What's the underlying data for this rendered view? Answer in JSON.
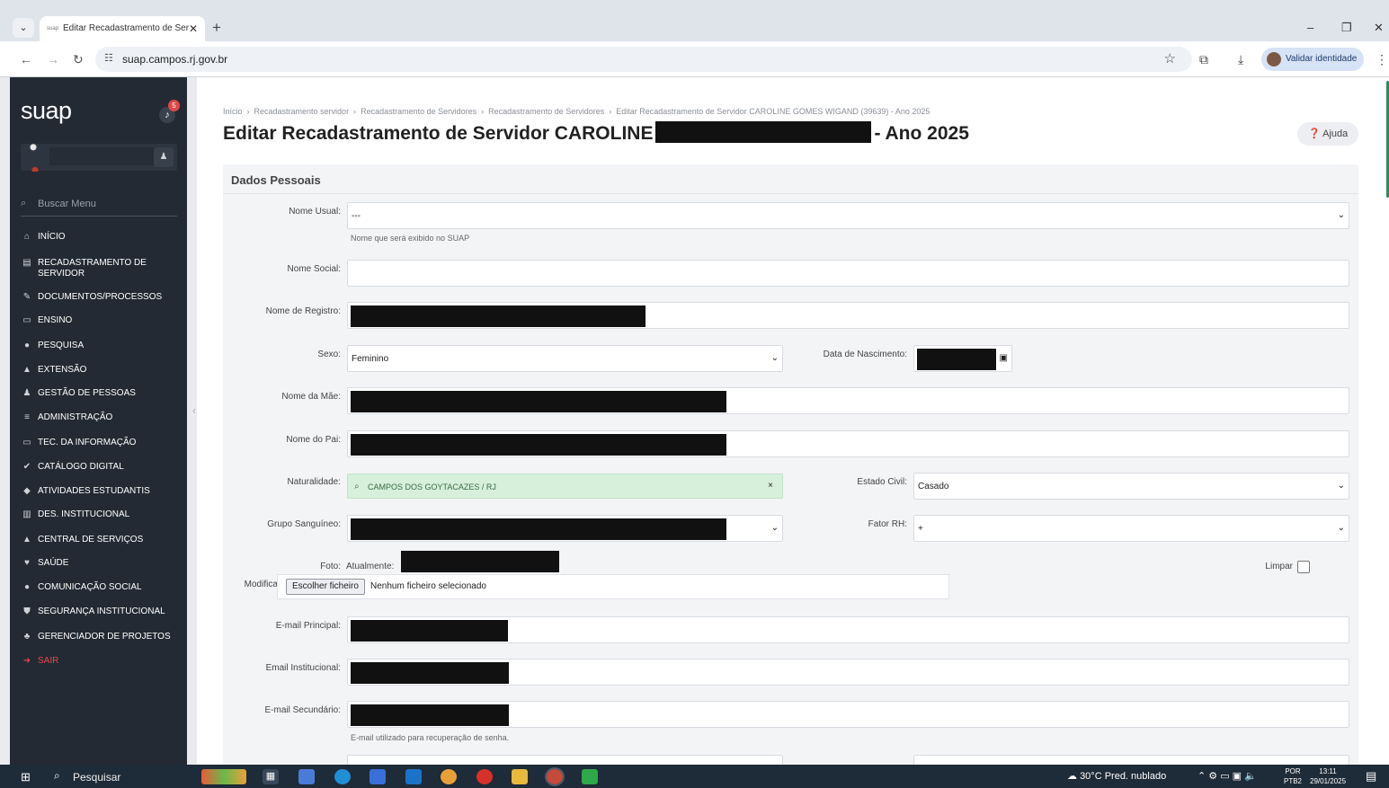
{
  "browser": {
    "tab_title": "Editar Recadastramento de Ser",
    "tab_favicon": "suap",
    "url": "suap.campos.rj.gov.br",
    "validate_identity_label": "Validar identidade"
  },
  "sidebar": {
    "brand": "suap",
    "notification_count": "5",
    "search_placeholder": "Buscar Menu",
    "items": [
      {
        "label": "Início",
        "icon": "home-icon",
        "glyph": "⌂"
      },
      {
        "label": "Recadastramento de Servidor",
        "icon": "file-icon",
        "glyph": "▤"
      },
      {
        "label": "Documentos/Processos",
        "icon": "edit-document-icon",
        "glyph": "✎"
      },
      {
        "label": "Ensino",
        "icon": "teaching-icon",
        "glyph": "▭"
      },
      {
        "label": "Pesquisa",
        "icon": "globe-icon",
        "glyph": "●"
      },
      {
        "label": "Extensão",
        "icon": "building-icon",
        "glyph": "▲"
      },
      {
        "label": "Gestão de Pessoas",
        "icon": "users-icon",
        "glyph": "♟"
      },
      {
        "label": "Administração",
        "icon": "list-icon",
        "glyph": "≡"
      },
      {
        "label": "Tec. da Informação",
        "icon": "laptop-icon",
        "glyph": "▭"
      },
      {
        "label": "Catálogo Digital",
        "icon": "check-circle-icon",
        "glyph": "✔"
      },
      {
        "label": "Atividades Estudantis",
        "icon": "graduation-cap-icon",
        "glyph": "◆"
      },
      {
        "label": "Des. Institucional",
        "icon": "bar-chart-icon",
        "glyph": "▥"
      },
      {
        "label": "Central de Serviços",
        "icon": "mountain-icon",
        "glyph": "▲"
      },
      {
        "label": "Saúde",
        "icon": "heart-icon",
        "glyph": "♥"
      },
      {
        "label": "Comunicação Social",
        "icon": "chat-bubble-icon",
        "glyph": "●"
      },
      {
        "label": "Segurança Institucional",
        "icon": "shield-icon",
        "glyph": "⛊"
      },
      {
        "label": "Gerenciador de Projetos",
        "icon": "sitemap-icon",
        "glyph": "♣"
      },
      {
        "label": "Sair",
        "icon": "sign-out-icon",
        "glyph": "➜"
      }
    ]
  },
  "breadcrumb": [
    "Início",
    "Recadastramento servidor",
    "Recadastramento de Servidores",
    "Recadastramento de Servidores",
    "Editar Recadastramento de Servidor CAROLINE GOMES WIGAND (39639) - Ano 2025"
  ],
  "page": {
    "title_prefix": "Editar Recadastramento de Servidor CAROLINE",
    "title_suffix": "- Ano 2025",
    "help_label": "Ajuda"
  },
  "form": {
    "section_title": "Dados Pessoais",
    "nome_usual": {
      "label": "Nome Usual:",
      "value": "---",
      "help": "Nome que será exibido no SUAP"
    },
    "nome_social": {
      "label": "Nome Social:",
      "value": ""
    },
    "nome_registro": {
      "label": "Nome de Registro:"
    },
    "sexo": {
      "label": "Sexo:",
      "value": "Feminino"
    },
    "data_nascimento": {
      "label": "Data de Nascimento:"
    },
    "nome_mae": {
      "label": "Nome da Mãe:"
    },
    "nome_pai": {
      "label": "Nome do Pai:"
    },
    "naturalidade": {
      "label": "Naturalidade:",
      "value": "CAMPOS DOS GOYTACAZES / RJ",
      "clear": "×"
    },
    "estado_civil": {
      "label": "Estado Civil:",
      "value": "Casado"
    },
    "grupo_sanguineo": {
      "label": "Grupo Sanguíneo:"
    },
    "fator_rh": {
      "label": "Fator RH:",
      "value": "+"
    },
    "foto": {
      "label": "Foto:",
      "current_label": "Atualmente:",
      "modify_label": "Modificar:",
      "button_label": "Escolher ficheiro",
      "no_file_text": "Nenhum ficheiro selecionado",
      "clear_label": "Limpar"
    },
    "email_principal": {
      "label": "E-mail Principal:"
    },
    "email_institucional": {
      "label": "Email Institucional:"
    },
    "email_secundario": {
      "label": "E-mail Secundário:",
      "help": "E-mail utilizado para recuperação de senha."
    }
  },
  "taskbar": {
    "search_label": "Pesquisar",
    "weather": "30°C  Pred. nublado",
    "language_1": "POR",
    "language_2": "PTB2",
    "time": "13:11",
    "date": "29/01/2025"
  }
}
